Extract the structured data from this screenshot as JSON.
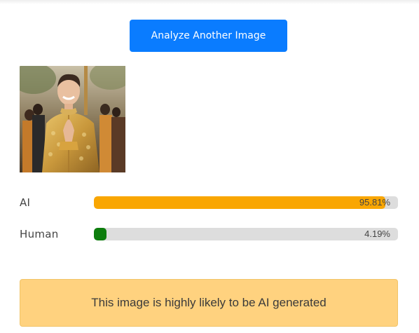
{
  "actions": {
    "analyze_another_label": "Analyze Another Image"
  },
  "image": {
    "description_icon": "analyzed-photo"
  },
  "results": [
    {
      "label": "AI",
      "percent_text": "95.81%",
      "value": 0.9581,
      "color": "#f9a602"
    },
    {
      "label": "Human",
      "percent_text": "4.19%",
      "value": 0.0419,
      "color": "#0d7d0d"
    }
  ],
  "verdict": {
    "text": "This image is highly likely to be AI generated",
    "background": "#ffd27f"
  },
  "colors": {
    "primary_button": "#0a7cff",
    "bar_track": "#dddddd"
  }
}
